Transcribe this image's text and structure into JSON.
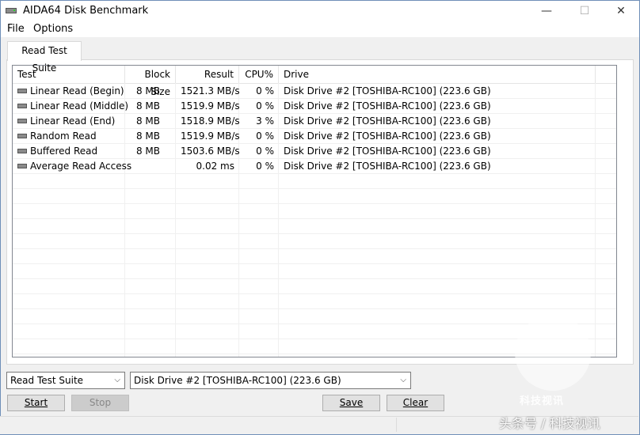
{
  "window": {
    "title": "AIDA64 Disk Benchmark",
    "minimize": "—",
    "maximize": "☐",
    "close": "✕"
  },
  "menu": {
    "file": "File",
    "options": "Options"
  },
  "tab": {
    "label": "Read Test Suite"
  },
  "table": {
    "headers": {
      "test": "Test",
      "block": "Block Size",
      "result": "Result",
      "cpu": "CPU%",
      "drive": "Drive"
    },
    "rows": [
      {
        "test": "Linear Read (Begin)",
        "block": "8 MB",
        "result": "1521.3 MB/s",
        "cpu": "0 %",
        "drive": "Disk Drive #2  [TOSHIBA-RC100]  (223.6 GB)"
      },
      {
        "test": "Linear Read (Middle)",
        "block": "8 MB",
        "result": "1519.9 MB/s",
        "cpu": "0 %",
        "drive": "Disk Drive #2  [TOSHIBA-RC100]  (223.6 GB)"
      },
      {
        "test": "Linear Read (End)",
        "block": "8 MB",
        "result": "1518.9 MB/s",
        "cpu": "3 %",
        "drive": "Disk Drive #2  [TOSHIBA-RC100]  (223.6 GB)"
      },
      {
        "test": "Random Read",
        "block": "8 MB",
        "result": "1519.9 MB/s",
        "cpu": "0 %",
        "drive": "Disk Drive #2  [TOSHIBA-RC100]  (223.6 GB)"
      },
      {
        "test": "Buffered Read",
        "block": "8 MB",
        "result": "1503.6 MB/s",
        "cpu": "0 %",
        "drive": "Disk Drive #2  [TOSHIBA-RC100]  (223.6 GB)"
      },
      {
        "test": "Average Read Access",
        "block": "",
        "result": "0.02 ms",
        "cpu": "0 %",
        "drive": "Disk Drive #2  [TOSHIBA-RC100]  (223.6 GB)"
      }
    ]
  },
  "controls": {
    "suite_select": "Read Test Suite",
    "drive_select": "Disk Drive #2  [TOSHIBA-RC100]  (223.6 GB)",
    "start": "Start",
    "stop": "Stop",
    "save": "Save",
    "clear": "Clear"
  },
  "watermark": {
    "logo_text": "科技视讯",
    "caption": "头条号 / 科技视讯"
  }
}
